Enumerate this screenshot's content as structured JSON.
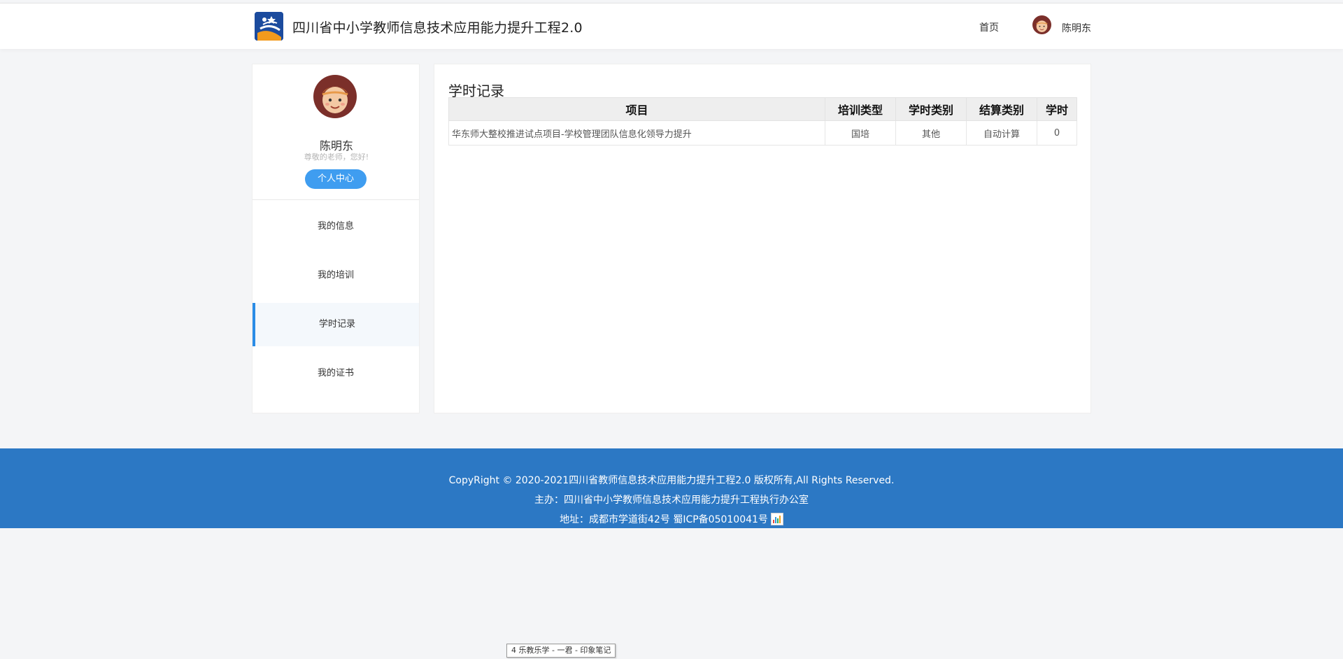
{
  "header": {
    "site_title": "四川省中小学教师信息技术应用能力提升工程2.0",
    "nav_home": "首页",
    "user_name": "陈明东"
  },
  "sidebar": {
    "name": "陈明东",
    "greeting": "尊敬的老师，您好!",
    "center_button": "个人中心",
    "menu": [
      {
        "label": "我的信息",
        "active": false
      },
      {
        "label": "我的培训",
        "active": false
      },
      {
        "label": "学时记录",
        "active": true
      },
      {
        "label": "我的证书",
        "active": false
      }
    ]
  },
  "content": {
    "title": "学时记录",
    "table": {
      "headers": [
        "项目",
        "培训类型",
        "学时类别",
        "结算类别",
        "学时"
      ],
      "rows": [
        [
          "华东师大整校推进试点项目-学校管理团队信息化领导力提升",
          "国培",
          "其他",
          "自动计算",
          "0"
        ]
      ]
    }
  },
  "footer": {
    "copyright": "CopyRight © 2020-2021四川省教师信息技术应用能力提升工程2.0 版权所有,All Rights Reserved.",
    "organizer": "主办：四川省中小学教师信息技术应用能力提升工程执行办公室",
    "address": "地址：成都市学道街42号 蜀ICP备05010041号"
  },
  "taskbar_tip": "4 乐教乐学 - 一君 - 印象笔记",
  "colors": {
    "accent": "#3f9df0",
    "active_bar": "#2a8ce6",
    "footer_bg": "#2c78c4",
    "page_bg": "#f4f5f7"
  }
}
